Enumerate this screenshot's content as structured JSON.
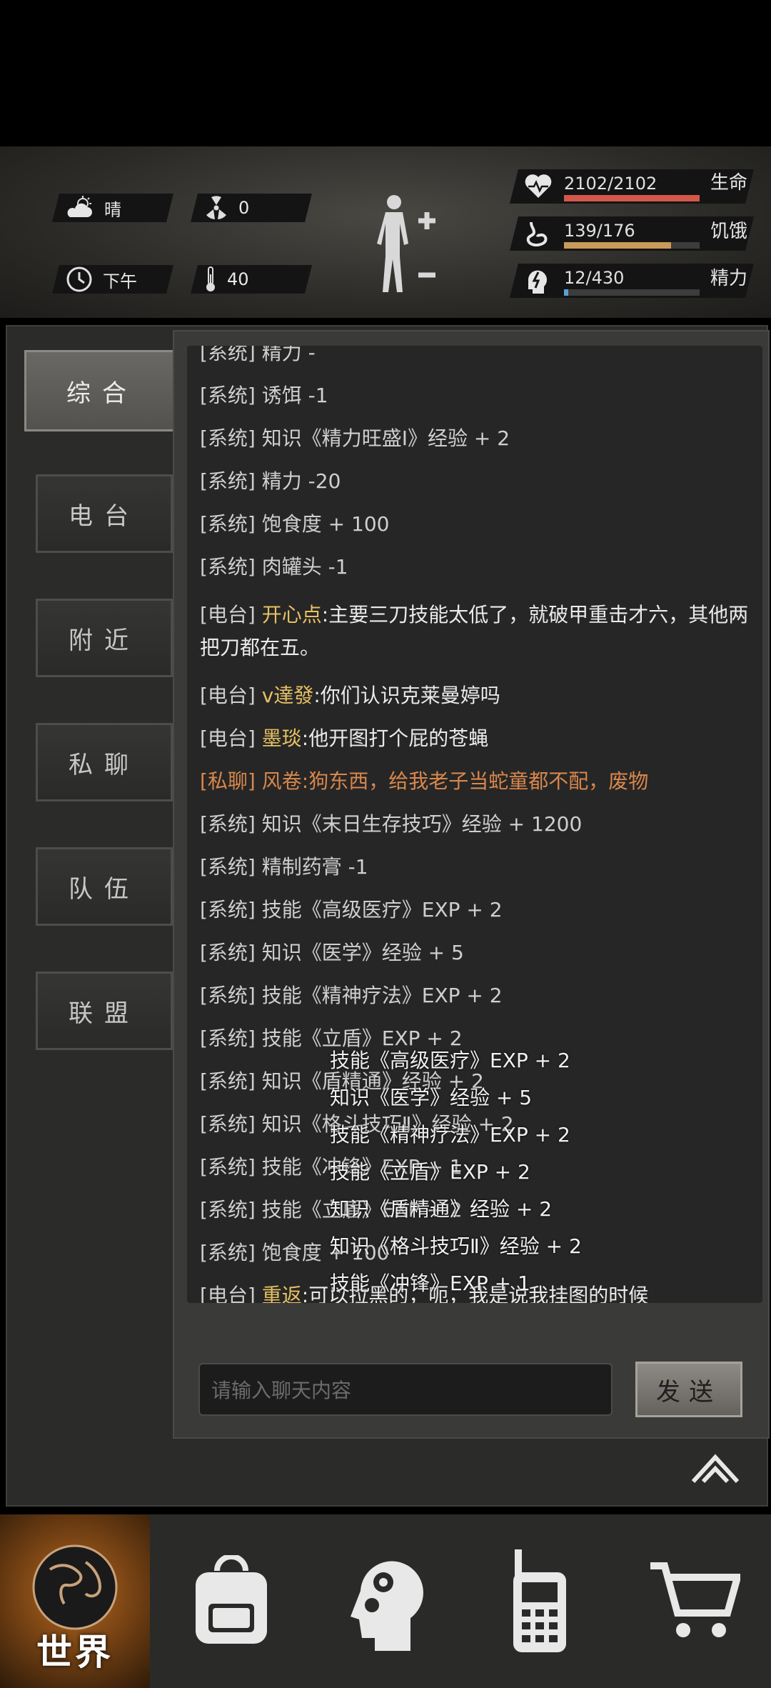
{
  "status": {
    "weather": {
      "icon": "partly-cloudy-icon",
      "label": "晴"
    },
    "radiation": {
      "icon": "radiation-icon",
      "value": "0"
    },
    "time": {
      "icon": "clock-icon",
      "label": "下午"
    },
    "temperature": {
      "icon": "thermometer-icon",
      "value": "40"
    },
    "body_icon": "body-silhouette-icon",
    "bars": [
      {
        "name": "health",
        "icon": "heart-pulse-icon",
        "value": "2102/2102",
        "label": "生命",
        "fill": 1.0,
        "color": "#d4574b"
      },
      {
        "name": "hunger",
        "icon": "stomach-icon",
        "value": "139/176",
        "label": "饥饿",
        "fill": 0.79,
        "color": "#c99a5a"
      },
      {
        "name": "energy",
        "icon": "energy-head-icon",
        "value": "12/430",
        "label": "精力",
        "fill": 0.03,
        "color": "#5aa0d8"
      }
    ]
  },
  "tabs": [
    "综合",
    "电台",
    "附近",
    "私聊",
    "队伍",
    "联盟"
  ],
  "messages": [
    {
      "type": "system",
      "tag": "[系统]",
      "text": "精力 -",
      "partial": true
    },
    {
      "type": "system",
      "tag": "[系统]",
      "text": "诱饵 -1"
    },
    {
      "type": "system",
      "tag": "[系统]",
      "text": "知识《精力旺盛Ⅰ》经验 + 2"
    },
    {
      "type": "system",
      "tag": "[系统]",
      "text": "精力 -20"
    },
    {
      "type": "system",
      "tag": "[系统]",
      "text": "饱食度 + 100"
    },
    {
      "type": "system",
      "tag": "[系统]",
      "text": "肉罐头 -1"
    },
    {
      "type": "radio",
      "tag": "[电台]",
      "sender": "开心点",
      "text": ":主要三刀技能太低了，就破甲重击才六，其他两把刀都在五。"
    },
    {
      "type": "radio",
      "tag": "[电台]",
      "sender": "v達發",
      "text": ":你们认识克莱曼婷吗"
    },
    {
      "type": "radio",
      "tag": "[电台]",
      "sender": "墨琰",
      "text": ":他开图打个屁的苍蝇"
    },
    {
      "type": "private",
      "tag": "[私聊]",
      "sender": "风卷",
      "text": ":狗东西，给我老子当蛇童都不配，废物"
    },
    {
      "type": "system",
      "tag": "[系统]",
      "text": "知识《末日生存技巧》经验 + 1200"
    },
    {
      "type": "system",
      "tag": "[系统]",
      "text": "精制药膏 -1"
    },
    {
      "type": "system",
      "tag": "[系统]",
      "text": "技能《高级医疗》EXP + 2"
    },
    {
      "type": "system",
      "tag": "[系统]",
      "text": "知识《医学》经验 + 5"
    },
    {
      "type": "system",
      "tag": "[系统]",
      "text": "技能《精神疗法》EXP + 2"
    },
    {
      "type": "system",
      "tag": "[系统]",
      "text": "技能《立盾》EXP + 2"
    },
    {
      "type": "system",
      "tag": "[系统]",
      "text": "知识《盾精通》经验 + 2"
    },
    {
      "type": "system",
      "tag": "[系统]",
      "text": "知识《格斗技巧Ⅱ》经验 + 2"
    },
    {
      "type": "system",
      "tag": "[系统]",
      "text": "技能《冲锋》EXP + 1"
    },
    {
      "type": "system",
      "tag": "[系统]",
      "text": "技能《立盾》EXP + 2"
    },
    {
      "type": "system",
      "tag": "[系统]",
      "text": "饱食度 + 100"
    },
    {
      "type": "radio",
      "tag": "[电台]",
      "sender": "重返",
      "text": ":可以拉黑的，呃，我是说我挂图的时候"
    }
  ],
  "floating_notices": [
    "技能《高级医疗》EXP + 2",
    "知识《医学》经验 + 5",
    "技能《精神疗法》EXP + 2",
    "技能《立盾》EXP + 2",
    "知识《盾精通》经验 + 2",
    "知识《格斗技巧Ⅱ》经验 + 2",
    "技能《冲锋》EXP + 1"
  ],
  "input": {
    "placeholder": "请输入聊天内容",
    "send_label": "发送"
  },
  "nav": [
    {
      "name": "world",
      "icon": "globe-icon",
      "label": "世界",
      "active": true
    },
    {
      "name": "backpack",
      "icon": "backpack-icon"
    },
    {
      "name": "skills",
      "icon": "head-gears-icon"
    },
    {
      "name": "radio",
      "icon": "walkie-talkie-icon"
    },
    {
      "name": "shop",
      "icon": "shopping-cart-icon"
    }
  ]
}
